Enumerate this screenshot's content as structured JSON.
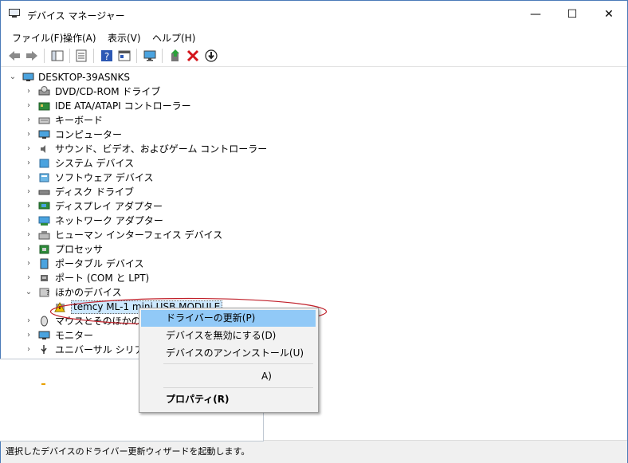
{
  "window": {
    "title": "デバイス マネージャー",
    "minimize": "—",
    "maximize": "☐",
    "close": "✕"
  },
  "menu": [
    "ファイル(F)",
    "操作(A)",
    "表示(V)",
    "ヘルプ(H)"
  ],
  "toolbar_icons": [
    "back-icon",
    "forward-icon",
    "show-hide-console-tree-icon",
    "properties-icon",
    "help-icon",
    "action-pane-icon",
    "monitor-scan-icon",
    "update-driver-icon",
    "uninstall-icon",
    "disable-icon"
  ],
  "tree": {
    "root": "DESKTOP-39ASNKS",
    "categories": [
      {
        "label": "DVD/CD-ROM ドライブ",
        "icon": "dvd-drive-icon"
      },
      {
        "label": "IDE ATA/ATAPI コントローラー",
        "icon": "ide-controller-icon"
      },
      {
        "label": "キーボード",
        "icon": "keyboard-icon"
      },
      {
        "label": "コンピューター",
        "icon": "computer-icon"
      },
      {
        "label": "サウンド、ビデオ、およびゲーム コントローラー",
        "icon": "sound-icon"
      },
      {
        "label": "システム デバイス",
        "icon": "system-device-icon"
      },
      {
        "label": "ソフトウェア デバイス",
        "icon": "software-device-icon"
      },
      {
        "label": "ディスク ドライブ",
        "icon": "disk-drive-icon"
      },
      {
        "label": "ディスプレイ アダプター",
        "icon": "display-adapter-icon"
      },
      {
        "label": "ネットワーク アダプター",
        "icon": "network-adapter-icon"
      },
      {
        "label": "ヒューマン インターフェイス デバイス",
        "icon": "hid-icon"
      },
      {
        "label": "プロセッサ",
        "icon": "processor-icon"
      },
      {
        "label": "ポータブル デバイス",
        "icon": "portable-device-icon"
      },
      {
        "label": "ポート (COM と LPT)",
        "icon": "port-icon"
      },
      {
        "label": "ほかのデバイス",
        "icon": "other-devices-icon"
      }
    ],
    "child": "temcy ML-1 mini USB MODULE",
    "after": [
      {
        "label": "マウスとそのほかのポイ",
        "icon": "mouse-icon"
      },
      {
        "label": "モニター",
        "icon": "monitor-icon"
      },
      {
        "label": "ユニバーサル シリアル /",
        "icon": "usb-icon"
      }
    ]
  },
  "context_menu": {
    "update": "ドライバーの更新(P)",
    "disable": "デバイスを無効にする(D)",
    "uninstall": "デバイスのアンインストール(U)",
    "scan_partial": "A)",
    "properties": "プロパティ(R)"
  },
  "status": "選択したデバイスのドライバー更新ウィザードを起動します。",
  "colors": {
    "highlight": "#91c9f7",
    "annotation": "#c0202a",
    "warning": "#f2c200"
  }
}
